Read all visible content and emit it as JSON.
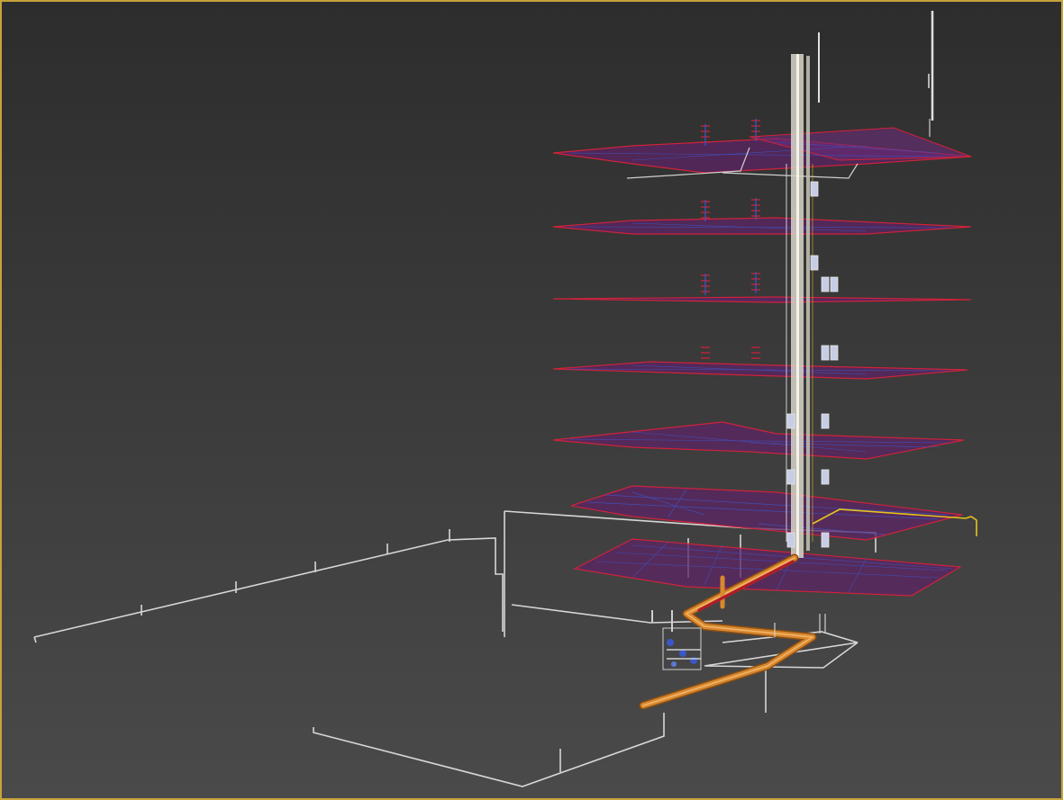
{
  "viewport": {
    "active_border_color": "#c7a33a",
    "background_top": "#2d2d2d",
    "background_bottom": "#4a4a4a",
    "view_type": "perspective-wireframe",
    "shading": "edged-faces"
  },
  "scene": {
    "floor_plate_color": "#7a2e8a",
    "floor_edge_color": "#d0223a",
    "duct_color": "#3b58c9",
    "riser_color": "#d8d6c8",
    "main_pipe_color": "#d8882e",
    "site_outline_color": "#d0d0d0",
    "gas_line_color": "#e6c21e",
    "floor_count": 7
  }
}
